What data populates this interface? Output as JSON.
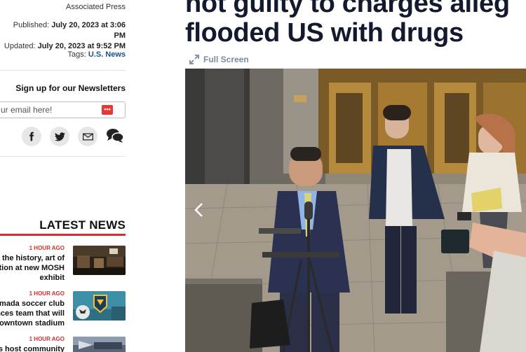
{
  "article_meta": {
    "author": "Associated Press",
    "published_label": "Published:",
    "published_value": "July 20, 2023 at 3:06 PM",
    "updated_label": "Updated:",
    "updated_value": "July 20, 2023 at 9:52 PM",
    "tags_label": "Tags:",
    "tag": "U.S. News"
  },
  "newsletter": {
    "title": "Sign up for our Newsletters",
    "placeholder": "ur email here!"
  },
  "share": {
    "icons": [
      "facebook-icon",
      "twitter-icon",
      "email-icon",
      "comments-icon"
    ]
  },
  "latest_news": {
    "title": "LATEST NEWS",
    "items": [
      {
        "time": "1 HOUR AGO",
        "line1": "r the history, art of",
        "line2": "tion at new MOSH",
        "line3": "exhibit"
      },
      {
        "time": "1 HOUR AGO",
        "line1": "rmada soccer club",
        "line2": "nces team that will",
        "line3": "owntown stadium"
      },
      {
        "time": "1 HOUR AGO",
        "line1": "rs host community",
        "line2": "",
        "line3": ""
      }
    ]
  },
  "article": {
    "headline_line1": "not guilty to charges alleg",
    "headline_line2": "flooded US with drugs",
    "fullscreen_label": "Full Screen"
  },
  "colors": {
    "accent": "#d32f2f",
    "headline": "#141a2e",
    "link": "#1f4e8c"
  }
}
